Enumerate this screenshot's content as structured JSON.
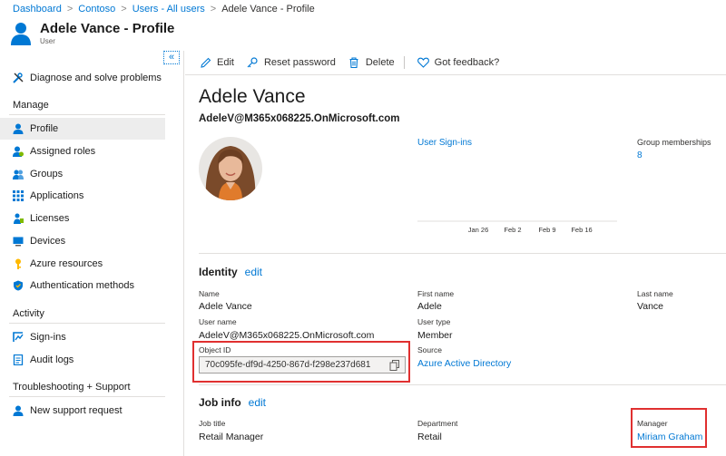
{
  "breadcrumb": {
    "items": [
      "Dashboard",
      "Contoso",
      "Users - All users"
    ],
    "current": "Adele Vance - Profile"
  },
  "header": {
    "title": "Adele Vance - Profile",
    "subtitle": "User"
  },
  "sidebar": {
    "collapse_label": "«",
    "diagnose": "Diagnose and solve problems",
    "manage_heading": "Manage",
    "manage_items": [
      {
        "label": "Profile",
        "icon": "user-icon",
        "active": true
      },
      {
        "label": "Assigned roles",
        "icon": "roles-icon"
      },
      {
        "label": "Groups",
        "icon": "groups-icon"
      },
      {
        "label": "Applications",
        "icon": "apps-grid-icon"
      },
      {
        "label": "Licenses",
        "icon": "license-icon"
      },
      {
        "label": "Devices",
        "icon": "device-icon"
      },
      {
        "label": "Azure resources",
        "icon": "key-icon"
      },
      {
        "label": "Authentication methods",
        "icon": "shield-icon"
      }
    ],
    "activity_heading": "Activity",
    "activity_items": [
      {
        "label": "Sign-ins",
        "icon": "signin-icon"
      },
      {
        "label": "Audit logs",
        "icon": "log-icon"
      }
    ],
    "support_heading": "Troubleshooting + Support",
    "support_items": [
      {
        "label": "New support request",
        "icon": "support-user-icon"
      }
    ]
  },
  "toolbar": {
    "edit": "Edit",
    "reset_password": "Reset password",
    "delete": "Delete",
    "feedback": "Got feedback?"
  },
  "profile": {
    "display_name": "Adele Vance",
    "upn": "AdeleV@M365x068225.OnMicrosoft.com",
    "signins_link": "User Sign-ins",
    "group_memberships_label": "Group memberships",
    "group_memberships_value": "8"
  },
  "chart_data": {
    "type": "line",
    "title": "User Sign-ins",
    "categories": [
      "Jan 26",
      "Feb 2",
      "Feb 9",
      "Feb 16"
    ],
    "series": [],
    "grid": false
  },
  "identity": {
    "title": "Identity",
    "edit": "edit",
    "name_label": "Name",
    "name_value": "Adele Vance",
    "first_name_label": "First name",
    "first_name_value": "Adele",
    "last_name_label": "Last name",
    "last_name_value": "Vance",
    "user_name_label": "User name",
    "user_name_value": "AdeleV@M365x068225.OnMicrosoft.com",
    "user_type_label": "User type",
    "user_type_value": "Member",
    "object_id_label": "Object ID",
    "object_id_value": "70c095fe-df9d-4250-867d-f298e237d681",
    "source_label": "Source",
    "source_value": "Azure Active Directory"
  },
  "job_info": {
    "title": "Job info",
    "edit": "edit",
    "job_title_label": "Job title",
    "job_title_value": "Retail Manager",
    "department_label": "Department",
    "department_value": "Retail",
    "manager_label": "Manager",
    "manager_value": "Miriam Graham"
  },
  "colors": {
    "accent": "#0078d4",
    "highlight": "#e03030",
    "active_nav": "#ededed"
  }
}
